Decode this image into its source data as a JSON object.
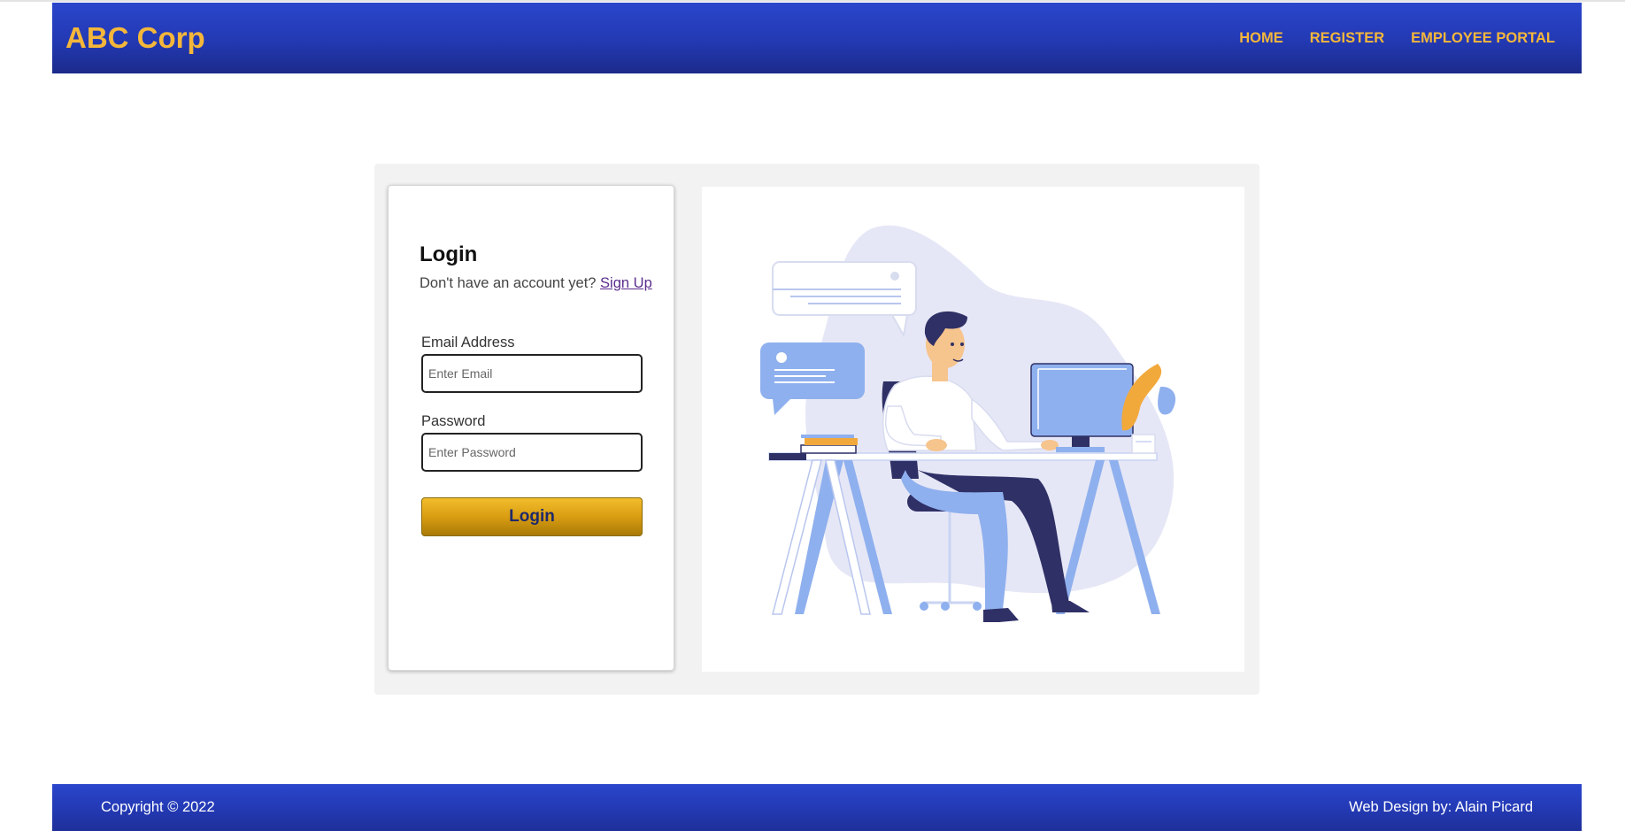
{
  "header": {
    "brand": "ABC Corp",
    "nav": [
      "HOME",
      "REGISTER",
      "EMPLOYEE PORTAL"
    ]
  },
  "login": {
    "title": "Login",
    "signup_prompt": "Don't have an account yet?",
    "signup_link": "Sign Up",
    "email_label": "Email Address",
    "email_placeholder": "Enter Email",
    "password_label": "Password",
    "password_placeholder": "Enter Password",
    "submit_label": "Login"
  },
  "footer": {
    "copyright": "Copyright © 2022",
    "credit": "Web Design by: Alain Picard"
  },
  "colors": {
    "header_blue": "#2339b3",
    "brand_gold": "#f5b73a",
    "button_gold": "#d99d12",
    "link_purple": "#5b2d8e"
  },
  "icons": {
    "illustration": "person-at-desk-illustration"
  }
}
